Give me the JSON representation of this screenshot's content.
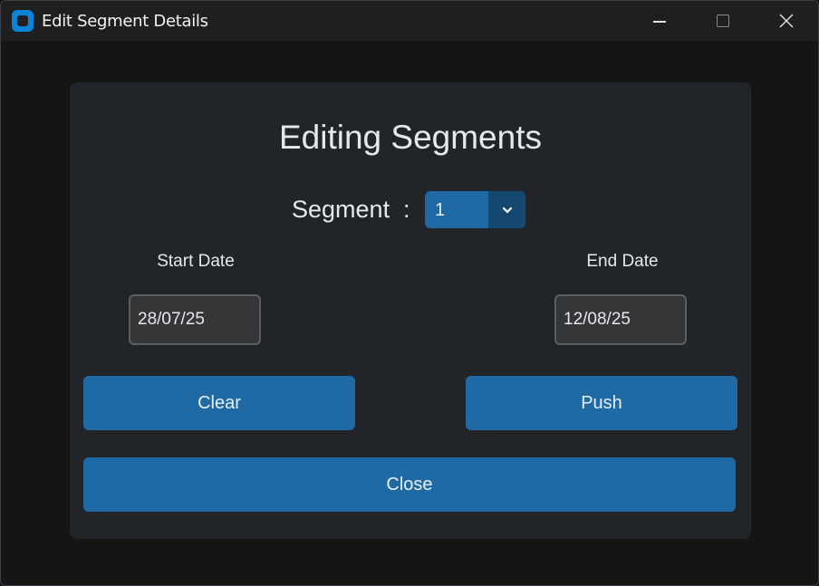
{
  "window": {
    "title": "Edit Segment Details",
    "controls": {
      "minimize": "minimize-icon",
      "maximize": "maximize-icon",
      "close": "close-icon"
    }
  },
  "form": {
    "heading": "Editing Segments",
    "segment": {
      "label": "Segment",
      "separator": ":",
      "selected": "1",
      "arrow_icon": "chevron-down-icon"
    },
    "start_date": {
      "label": "Start Date",
      "value": "28/07/25"
    },
    "end_date": {
      "label": "End Date",
      "value": "12/08/25"
    },
    "buttons": {
      "clear": "Clear",
      "push": "Push",
      "close": "Close"
    }
  },
  "colors": {
    "accent": "#1f6aa5",
    "accent_dark": "#144870",
    "panel": "#212429",
    "background": "#151515",
    "input_bg": "#343638",
    "input_border": "#5a5d62",
    "text": "#e6e8eb",
    "app_icon": "#0a84d8"
  }
}
